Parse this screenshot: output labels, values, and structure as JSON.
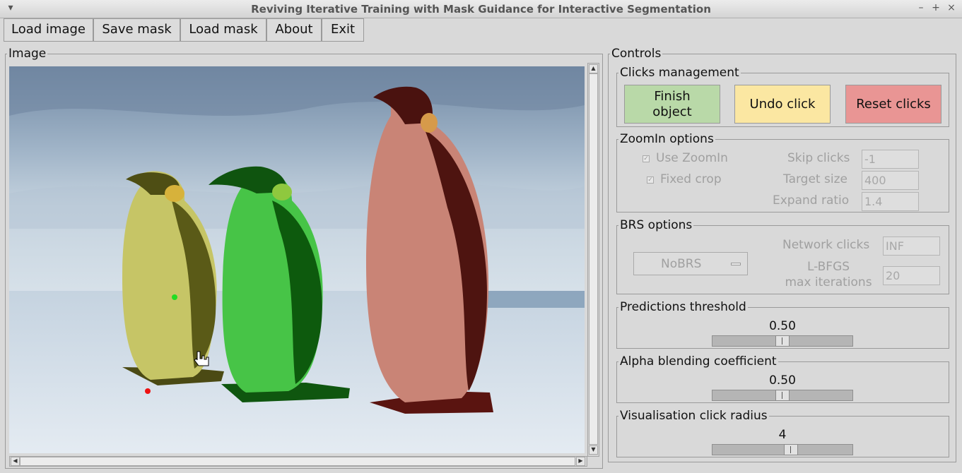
{
  "window": {
    "title": "Reviving Iterative Training with Mask Guidance for Interactive Segmentation",
    "controls": [
      "▾",
      "–",
      "+",
      "×"
    ]
  },
  "menu": [
    {
      "label": "Load image"
    },
    {
      "label": "Save mask"
    },
    {
      "label": "Load mask"
    },
    {
      "label": "About"
    },
    {
      "label": "Exit"
    }
  ],
  "image_panel": {
    "legend": "Image"
  },
  "controls_panel": {
    "legend": "Controls",
    "clicks": {
      "legend": "Clicks management",
      "finish": "Finish\nobject",
      "undo": "Undo click",
      "reset": "Reset clicks"
    },
    "zoomin": {
      "legend": "ZoomIn options",
      "use_zoomin": "Use ZoomIn",
      "fixed_crop": "Fixed crop",
      "skip_clicks_label": "Skip clicks",
      "skip_clicks_value": "-1",
      "target_size_label": "Target size",
      "target_size_value": "400",
      "expand_ratio_label": "Expand ratio",
      "expand_ratio_value": "1.4"
    },
    "brs": {
      "legend": "BRS options",
      "mode": "NoBRS",
      "network_clicks_label": "Network clicks",
      "network_clicks_value": "INF",
      "lbfgs_label_1": "L-BFGS",
      "lbfgs_label_2": "max iterations",
      "lbfgs_value": "20"
    },
    "threshold": {
      "legend": "Predictions threshold",
      "value": "0.50",
      "level": 0.5
    },
    "alpha": {
      "legend": "Alpha blending coefficient",
      "value": "0.50",
      "level": 0.5
    },
    "radius": {
      "legend": "Visualisation click radius",
      "value": "4",
      "level": 0.57
    }
  },
  "colors": {
    "finish_bg": "#b9d9a8",
    "undo_bg": "#fbe7a2",
    "reset_bg": "#e99594",
    "mask_yellow": "#c8c860",
    "mask_green": "#33b833",
    "mask_red": "#c97b6f",
    "pos_click": "#22dd22",
    "neg_click": "#ee1111"
  }
}
